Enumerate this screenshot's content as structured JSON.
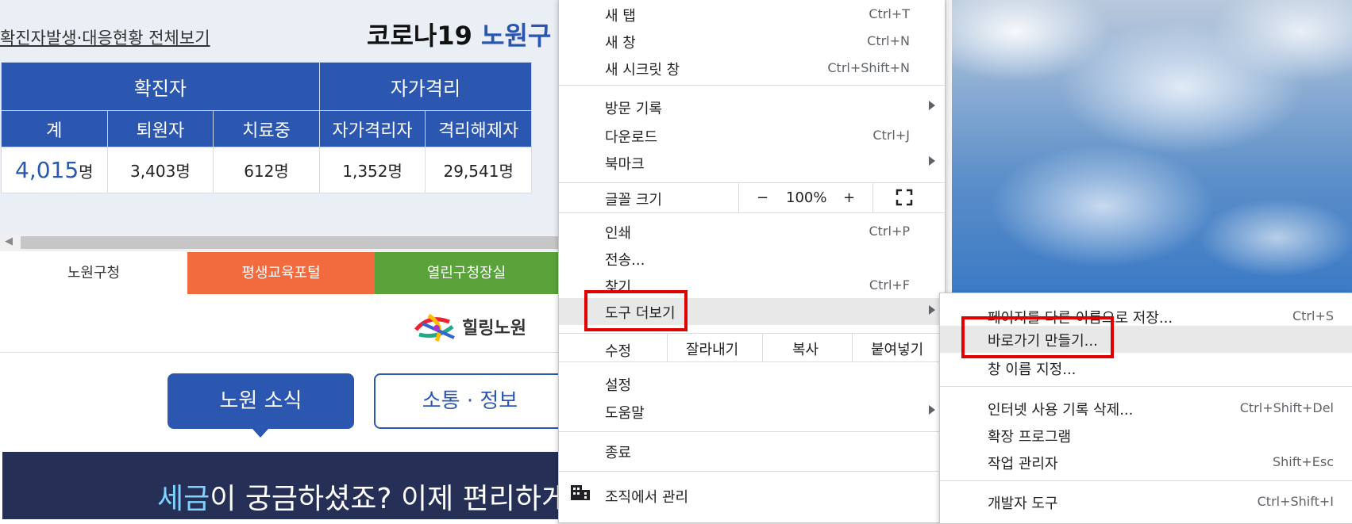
{
  "webpage": {
    "link_all": "확진자발생·대응현황 전체보기",
    "covid_title_prefix": "코로나19 ",
    "covid_title_highlight": "노원구",
    "table": {
      "group_headers": [
        "확진자",
        "자가격리"
      ],
      "headers": [
        "계",
        "퇴원자",
        "치료중",
        "자가격리자",
        "격리해제자"
      ],
      "values": [
        "4,015",
        "3,403",
        "612",
        "1,352",
        "29,541"
      ],
      "unit": "명"
    },
    "tabs": [
      "노원구청",
      "평생교육포털",
      "열린구청장실"
    ],
    "logo_text": "힐링노원",
    "button_news": "노원 소식",
    "button_info": "소통 · 정보",
    "banner_highlight": "세금",
    "banner_text": "이 궁금하셨죠? 이제 편리하게"
  },
  "menu": {
    "items": {
      "new_tab": {
        "label": "새 탭",
        "shortcut": "Ctrl+T"
      },
      "new_window": {
        "label": "새 창",
        "shortcut": "Ctrl+N"
      },
      "incognito": {
        "label": "새 시크릿 창",
        "shortcut": "Ctrl+Shift+N"
      },
      "history": {
        "label": "방문 기록"
      },
      "downloads": {
        "label": "다운로드",
        "shortcut": "Ctrl+J"
      },
      "bookmarks": {
        "label": "북마크"
      },
      "zoom": {
        "label": "글꼴 크기",
        "minus": "−",
        "value": "100%",
        "plus": "+"
      },
      "print": {
        "label": "인쇄",
        "shortcut": "Ctrl+P"
      },
      "cast": {
        "label": "전송..."
      },
      "find": {
        "label": "찾기",
        "shortcut": "Ctrl+F"
      },
      "more_tools": {
        "label": "도구 더보기"
      },
      "edit": {
        "label": "수정",
        "cut": "잘라내기",
        "copy": "복사",
        "paste": "붙여넣기"
      },
      "settings": {
        "label": "설정"
      },
      "help": {
        "label": "도움말"
      },
      "exit": {
        "label": "종료"
      },
      "managed": {
        "label": "조직에서 관리"
      }
    }
  },
  "submenu": {
    "items": {
      "save_as": {
        "label": "페이지를 다른 이름으로 저장...",
        "shortcut": "Ctrl+S"
      },
      "create_shortcut": {
        "label": "바로가기 만들기..."
      },
      "name_window": {
        "label": "창 이름 지정..."
      },
      "clear_data": {
        "label": "인터넷 사용 기록 삭제...",
        "shortcut": "Ctrl+Shift+Del"
      },
      "extensions": {
        "label": "확장 프로그램"
      },
      "task_manager": {
        "label": "작업 관리자",
        "shortcut": "Shift+Esc"
      },
      "dev_tools": {
        "label": "개발자 도구",
        "shortcut": "Ctrl+Shift+I"
      }
    }
  },
  "colors": {
    "highlight_box": "#e00000",
    "site_blue": "#2b57b1"
  }
}
